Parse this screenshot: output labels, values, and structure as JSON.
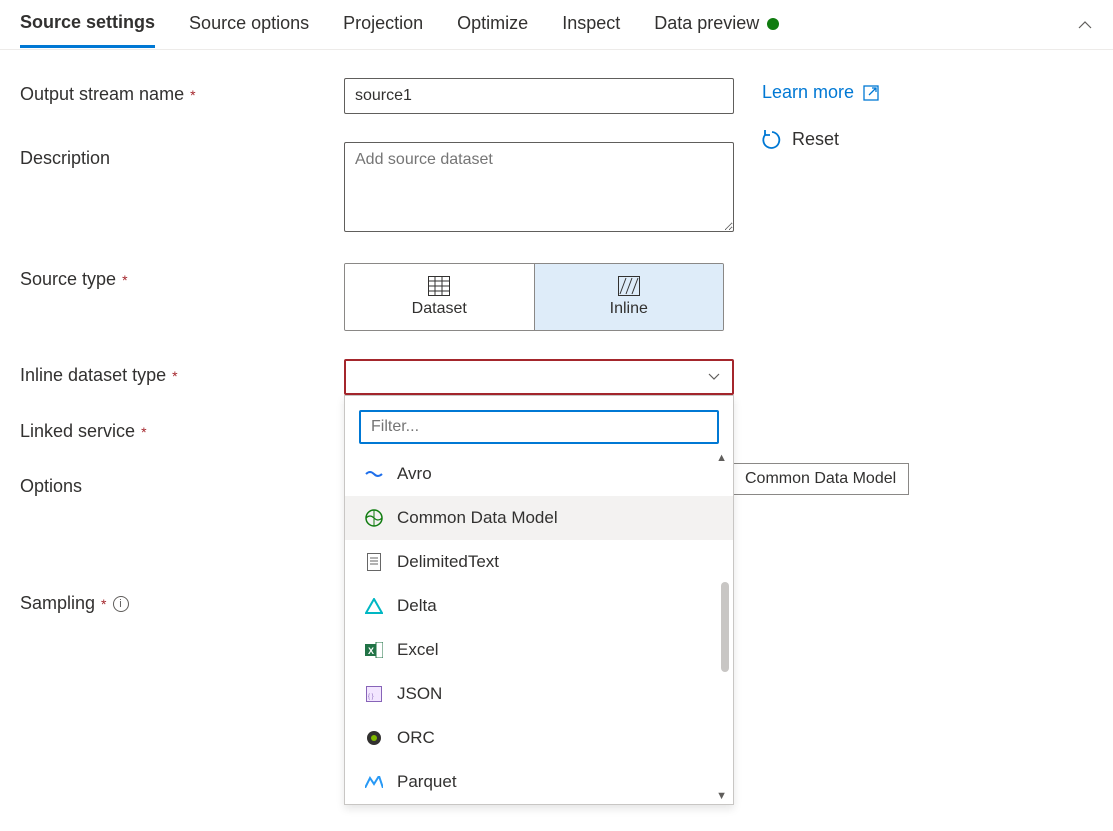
{
  "tabs": {
    "items": [
      "Source settings",
      "Source options",
      "Projection",
      "Optimize",
      "Inspect",
      "Data preview"
    ],
    "active_index": 0,
    "preview_status": "green"
  },
  "form": {
    "output_stream_name": {
      "label": "Output stream name",
      "value": "source1"
    },
    "description": {
      "label": "Description",
      "placeholder": "Add source dataset",
      "value": ""
    },
    "source_type": {
      "label": "Source type",
      "options": [
        "Dataset",
        "Inline"
      ],
      "selected": "Inline"
    },
    "inline_dataset_type": {
      "label": "Inline dataset type",
      "value": ""
    },
    "linked_service": {
      "label": "Linked service"
    },
    "options": {
      "label": "Options"
    },
    "sampling": {
      "label": "Sampling"
    }
  },
  "dropdown": {
    "filter_placeholder": "Filter...",
    "items": [
      {
        "name": "Avro",
        "icon": "avro",
        "color": "#1f6feb"
      },
      {
        "name": "Common Data Model",
        "icon": "cdm",
        "color": "#107c10",
        "hover": true
      },
      {
        "name": "DelimitedText",
        "icon": "text",
        "color": "#666"
      },
      {
        "name": "Delta",
        "icon": "delta",
        "color": "#00b7c3"
      },
      {
        "name": "Excel",
        "icon": "excel",
        "color": "#217346"
      },
      {
        "name": "JSON",
        "icon": "json",
        "color": "#8764b8"
      },
      {
        "name": "ORC",
        "icon": "orc",
        "color": "#107c10"
      },
      {
        "name": "Parquet",
        "icon": "parquet",
        "color": "#2899f5"
      }
    ],
    "tooltip": "Common Data Model"
  },
  "side": {
    "learn_more": "Learn more",
    "reset": "Reset"
  }
}
